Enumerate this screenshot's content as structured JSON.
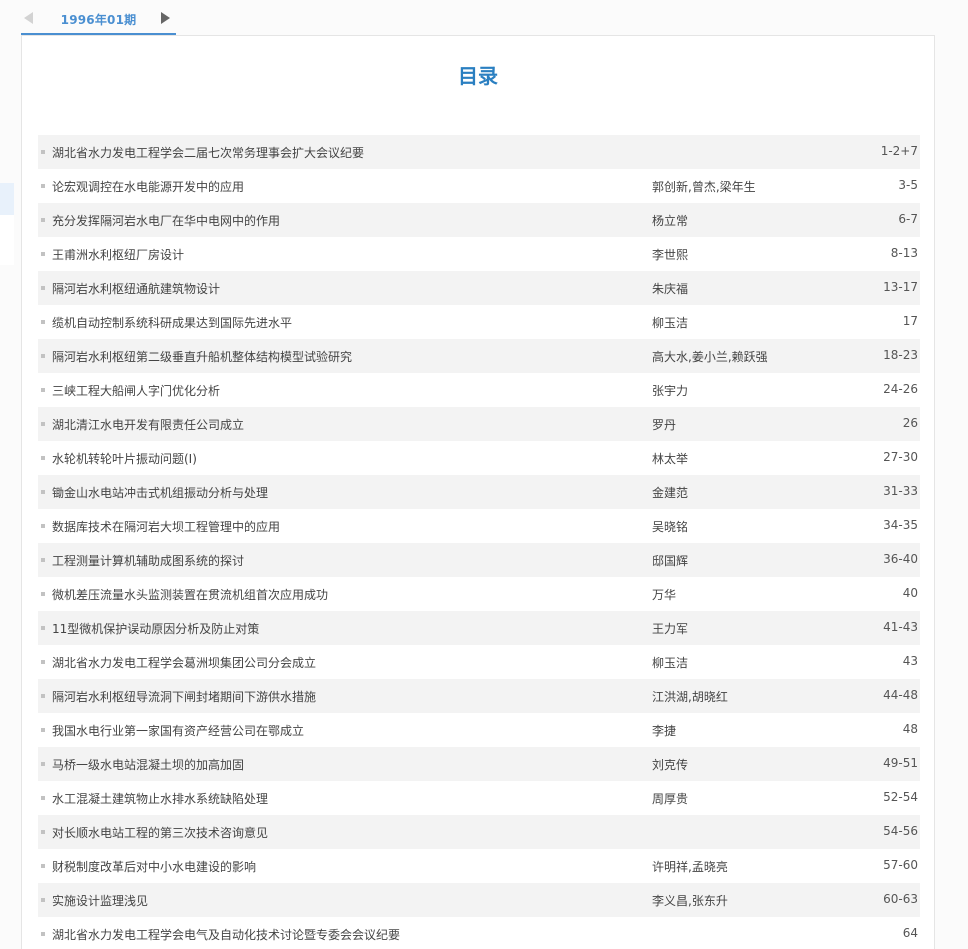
{
  "issue_tab": {
    "label": "1996年01期"
  },
  "page_title": "目录",
  "articles": [
    {
      "title": "湖北省水力发电工程学会二届七次常务理事会扩大会议纪要",
      "authors": "",
      "pages": "1-2+7"
    },
    {
      "title": "论宏观调控在水电能源开发中的应用",
      "authors": "郭创新,曾杰,梁年生",
      "pages": "3-5"
    },
    {
      "title": "充分发挥隔河岩水电厂在华中电网中的作用",
      "authors": "杨立常",
      "pages": "6-7"
    },
    {
      "title": "王甫洲水利枢纽厂房设计",
      "authors": "李世熙",
      "pages": "8-13"
    },
    {
      "title": "隔河岩水利枢纽通航建筑物设计",
      "authors": "朱庆福",
      "pages": "13-17"
    },
    {
      "title": "缆机自动控制系统科研成果达到国际先进水平",
      "authors": "柳玉洁",
      "pages": "17"
    },
    {
      "title": "隔河岩水利枢纽第二级垂直升船机整体结构模型试验研究",
      "authors": "高大水,姜小兰,赖跃强",
      "pages": "18-23"
    },
    {
      "title": "三峡工程大船闸人字门优化分析",
      "authors": "张宇力",
      "pages": "24-26"
    },
    {
      "title": "湖北清江水电开发有限责任公司成立",
      "authors": "罗丹",
      "pages": "26"
    },
    {
      "title": "水轮机转轮叶片振动问题(Ⅰ)",
      "authors": "林太举",
      "pages": "27-30"
    },
    {
      "title": "锄金山水电站冲击式机组振动分析与处理",
      "authors": "金建范",
      "pages": "31-33"
    },
    {
      "title": "数据库技术在隔河岩大坝工程管理中的应用",
      "authors": "吴晓铭",
      "pages": "34-35"
    },
    {
      "title": "工程测量计算机辅助成图系统的探讨",
      "authors": "邸国辉",
      "pages": "36-40"
    },
    {
      "title": "微机差压流量水头监测装置在贯流机组首次应用成功",
      "authors": "万华",
      "pages": "40"
    },
    {
      "title": "11型微机保护误动原因分析及防止对策",
      "authors": "王力军",
      "pages": "41-43"
    },
    {
      "title": "湖北省水力发电工程学会葛洲坝集团公司分会成立",
      "authors": "柳玉洁",
      "pages": "43"
    },
    {
      "title": "隔河岩水利枢纽导流洞下闸封堵期间下游供水措施",
      "authors": "江洪湖,胡晓红",
      "pages": "44-48"
    },
    {
      "title": "我国水电行业第一家国有资产经营公司在鄂成立",
      "authors": "李捷",
      "pages": "48"
    },
    {
      "title": "马桥一级水电站混凝土坝的加高加固",
      "authors": "刘克传",
      "pages": "49-51"
    },
    {
      "title": "水工混凝土建筑物止水排水系统缺陷处理",
      "authors": "周厚贵",
      "pages": "52-54"
    },
    {
      "title": "对长顺水电站工程的第三次技术咨询意见",
      "authors": "",
      "pages": "54-56"
    },
    {
      "title": "财税制度改革后对中小水电建设的影响",
      "authors": "许明祥,孟晓亮",
      "pages": "57-60"
    },
    {
      "title": "实施设计监理浅见",
      "authors": "李义昌,张东升",
      "pages": "60-63"
    },
    {
      "title": "湖北省水力发电工程学会电气及自动化技术讨论暨专委会会议纪要",
      "authors": "",
      "pages": "64"
    }
  ]
}
